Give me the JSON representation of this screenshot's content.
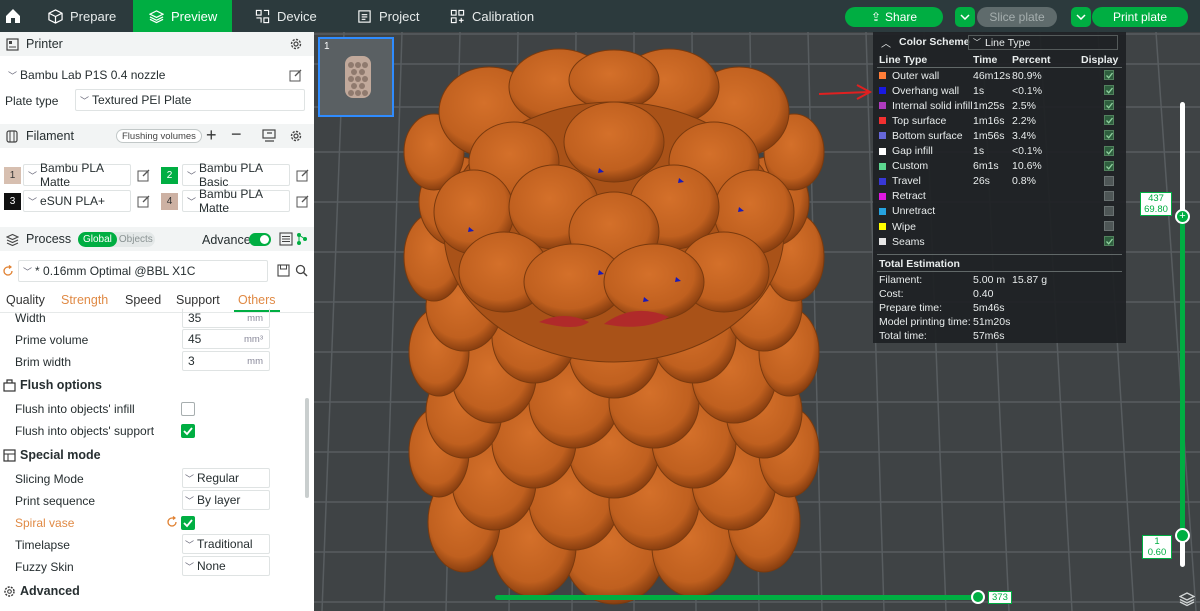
{
  "topbar": {
    "tabs": [
      {
        "label": "Prepare",
        "icon": "cube-icon",
        "active": false
      },
      {
        "label": "Preview",
        "icon": "layers-icon",
        "active": true
      },
      {
        "label": "Device",
        "icon": "device-icon",
        "active": false
      },
      {
        "label": "Project",
        "icon": "document-icon",
        "active": false
      },
      {
        "label": "Calibration",
        "icon": "calibration-icon",
        "active": false
      }
    ],
    "share": "Share",
    "slice_plate": "Slice plate",
    "print_plate": "Print plate"
  },
  "printer": {
    "section_title": "Printer",
    "preset": "Bambu Lab P1S 0.4 nozzle",
    "plate_type_label": "Plate type",
    "plate_type": "Textured PEI Plate"
  },
  "filament": {
    "section_title": "Filament",
    "flushing_volumes": "Flushing volumes",
    "slots": [
      {
        "num": "1",
        "name": "Bambu PLA Matte",
        "color": "#d7bfb0",
        "text_color": "#333333"
      },
      {
        "num": "2",
        "name": "Bambu PLA Basic",
        "color": "#00ae42",
        "text_color": "#ffffff"
      },
      {
        "num": "3",
        "name": "eSUN PLA+",
        "color": "#111111",
        "text_color": "#ffffff"
      },
      {
        "num": "4",
        "name": "Bambu PLA Matte",
        "color": "#cdb1a3",
        "text_color": "#333333"
      }
    ]
  },
  "process": {
    "section_title": "Process",
    "global": "Global",
    "objects": "Objects",
    "advanced": "Advance",
    "preset": "* 0.16mm Optimal @BBL X1C",
    "tabs": [
      "Quality",
      "Strength",
      "Speed",
      "Support",
      "Others"
    ],
    "active_tab": "Others"
  },
  "settings": {
    "width": {
      "label": "Width",
      "value": "35",
      "unit": "mm"
    },
    "prime_volume": {
      "label": "Prime volume",
      "value": "45",
      "unit": "mm³"
    },
    "brim_width": {
      "label": "Brim width",
      "value": "3",
      "unit": "mm"
    },
    "flush_group": "Flush options",
    "flush_infill": {
      "label": "Flush into objects' infill",
      "checked": false
    },
    "flush_support": {
      "label": "Flush into objects' support",
      "checked": true
    },
    "special_group": "Special mode",
    "slicing_mode": {
      "label": "Slicing Mode",
      "value": "Regular"
    },
    "print_sequence": {
      "label": "Print sequence",
      "value": "By layer"
    },
    "spiral_vase": {
      "label": "Spiral vase",
      "checked": true
    },
    "timelapse": {
      "label": "Timelapse",
      "value": "Traditional"
    },
    "fuzzy_skin": {
      "label": "Fuzzy Skin",
      "value": "None"
    },
    "advanced_group": "Advanced"
  },
  "plate_thumb": {
    "number": "1"
  },
  "color_scheme": {
    "title": "Color Scheme",
    "selector": "Line Type",
    "headers": [
      "Line Type",
      "Time",
      "Percent",
      "Display"
    ],
    "rows": [
      {
        "name": "Outer wall",
        "color": "#ff7d38",
        "time": "46m12s",
        "percent": "80.9%",
        "display": true
      },
      {
        "name": "Overhang wall",
        "color": "#1919e0",
        "time": "1s",
        "percent": "<0.1%",
        "display": true
      },
      {
        "name": "Internal solid infill",
        "color": "#b03bbf",
        "time": "1m25s",
        "percent": "2.5%",
        "display": true
      },
      {
        "name": "Top surface",
        "color": "#f23030",
        "time": "1m16s",
        "percent": "2.2%",
        "display": true
      },
      {
        "name": "Bottom surface",
        "color": "#6666d9",
        "time": "1m56s",
        "percent": "3.4%",
        "display": true
      },
      {
        "name": "Gap infill",
        "color": "#ffffff",
        "time": "1s",
        "percent": "<0.1%",
        "display": true
      },
      {
        "name": "Custom",
        "color": "#5cd68f",
        "time": "6m1s",
        "percent": "10.6%",
        "display": true
      },
      {
        "name": "Travel",
        "color": "#3838d6",
        "time": "26s",
        "percent": "0.8%",
        "display": false
      },
      {
        "name": "Retract",
        "color": "#e018e0",
        "time": "",
        "percent": "",
        "display": false
      },
      {
        "name": "Unretract",
        "color": "#26a3e0",
        "time": "",
        "percent": "",
        "display": false
      },
      {
        "name": "Wipe",
        "color": "#ffff00",
        "time": "",
        "percent": "",
        "display": false
      },
      {
        "name": "Seams",
        "color": "#e6e6e6",
        "time": "",
        "percent": "",
        "display": true
      }
    ],
    "total_title": "Total Estimation",
    "filament_label": "Filament:",
    "filament_m": "5.00 m",
    "filament_g": "15.87 g",
    "cost_label": "Cost:",
    "cost": "0.40",
    "prepare_label": "Prepare time:",
    "prepare": "5m46s",
    "model_label": "Model printing time:",
    "model": "51m20s",
    "total_label": "Total time:",
    "total": "57m6s"
  },
  "layer_slider": {
    "top_layer": "437",
    "top_height": "69.80",
    "bottom_layer": "1",
    "bottom_height": "0.60"
  },
  "move_slider": {
    "value": "373"
  }
}
